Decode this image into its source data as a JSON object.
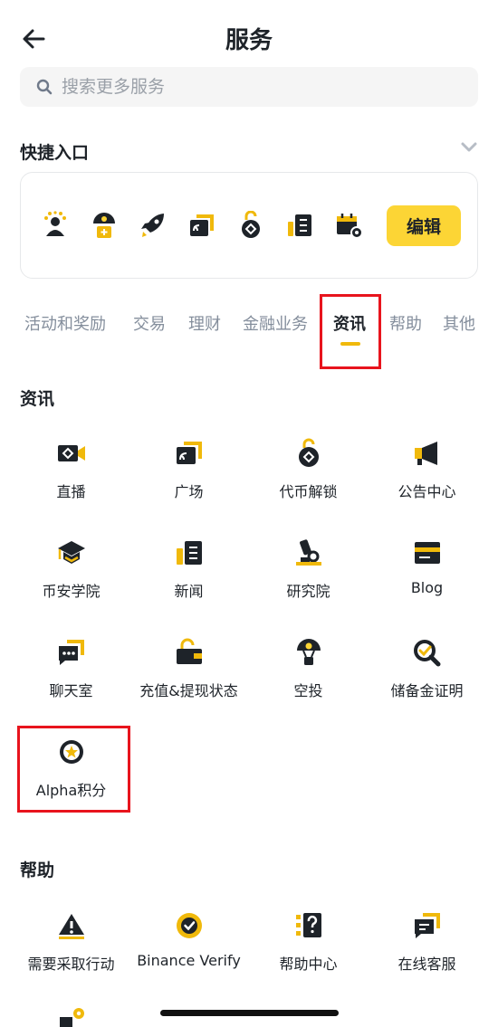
{
  "header": {
    "title": "服务"
  },
  "search": {
    "placeholder": "搜索更多服务"
  },
  "quick": {
    "title": "快捷入口",
    "icons": [
      "referral-icon",
      "airdrop-icon",
      "launchpad-icon",
      "square-icon",
      "token-unlock-icon",
      "news-icon",
      "calendar-icon"
    ],
    "edit_label": "编辑"
  },
  "tabs": [
    {
      "label": "活动和奖励",
      "active": false
    },
    {
      "label": "交易",
      "active": false
    },
    {
      "label": "理财",
      "active": false
    },
    {
      "label": "金融业务",
      "active": false
    },
    {
      "label": "资讯",
      "active": true
    },
    {
      "label": "帮助",
      "active": false
    },
    {
      "label": "其他",
      "active": false
    }
  ],
  "news": {
    "title": "资讯",
    "items": [
      {
        "label": "直播",
        "icon": "live-icon"
      },
      {
        "label": "广场",
        "icon": "square-icon"
      },
      {
        "label": "代币解锁",
        "icon": "token-unlock-icon"
      },
      {
        "label": "公告中心",
        "icon": "announcement-icon"
      },
      {
        "label": "币安学院",
        "icon": "academy-icon"
      },
      {
        "label": "新闻",
        "icon": "news-icon"
      },
      {
        "label": "研究院",
        "icon": "research-icon"
      },
      {
        "label": "Blog",
        "icon": "blog-icon"
      },
      {
        "label": "聊天室",
        "icon": "chatroom-icon"
      },
      {
        "label": "充值&提现状态",
        "icon": "deposit-status-icon"
      },
      {
        "label": "空投",
        "icon": "airdrop-icon"
      },
      {
        "label": "储备金证明",
        "icon": "proof-of-reserves-icon"
      },
      {
        "label": "Alpha积分",
        "icon": "alpha-points-icon"
      }
    ]
  },
  "help": {
    "title": "帮助",
    "items": [
      {
        "label": "需要采取行动",
        "icon": "warning-icon"
      },
      {
        "label": "Binance Verify",
        "icon": "verify-icon"
      },
      {
        "label": "帮助中心",
        "icon": "help-center-icon"
      },
      {
        "label": "在线客服",
        "icon": "support-chat-icon"
      }
    ]
  },
  "colors": {
    "accent": "#fcd535",
    "yellow": "#f0b90b",
    "dark": "#1e2329",
    "muted": "#848e9c",
    "highlight": "#e8141d"
  }
}
